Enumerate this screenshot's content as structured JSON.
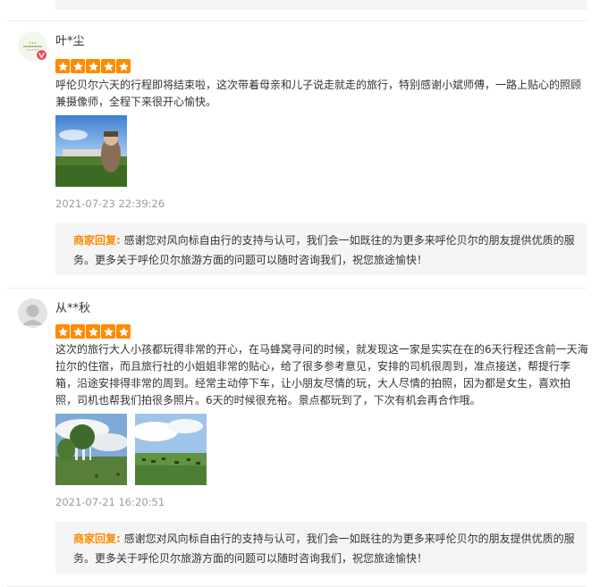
{
  "reviews": [
    {
      "username": "叶*尘",
      "rating": 5,
      "content": "呼伦贝尔六天的行程即将结束啦，这次带着母亲和儿子说走就走的旅行，特别感谢小斌师傅，一路上贴心的照顾兼摄像师，全程下来很开心愉快。",
      "photos": [
        "photo-grassland-figure"
      ],
      "time": "2021-07-23 22:39:26",
      "reply_label": "商家回复:",
      "reply_text": "感谢您对风向标自由行的支持与认可，我们会一如既往的为更多来呼伦贝尔的朋友提供优质的服务。更多关于呼伦贝尔旅游方面的问题可以随时咨询我们，祝您旅途愉快！"
    },
    {
      "username": "从**秋",
      "rating": 5,
      "content": "这次的旅行大人小孩都玩得非常的开心，在马蜂窝寻问的时候，就发现这一家是实实在在的6天行程还含前一天海拉尔的住宿，而且旅行社的小姐姐非常的贴心，给了很多参考意见，安排的司机很周到，准点接送，帮提行李箱，沿途安排得非常的周到。经常主动停下车，让小朋友尽情的玩，大人尽情的拍照，因为都是女生，喜欢拍照，司机也帮我们拍很多照片。6天的时候很充裕。景点都玩到了，下次有机会再合作哦。",
      "photos": [
        "photo-birch-trees",
        "photo-herd-grassland"
      ],
      "time": "2021-07-21 16:20:51",
      "reply_label": "商家回复:",
      "reply_text": "感谢您对风向标自由行的支持与认可，我们会一如既往的为更多来呼伦贝尔的朋友提供优质的服务。更多关于呼伦贝尔旅游方面的问题可以随时咨询我们，祝您旅途愉快！"
    }
  ],
  "colors": {
    "star": "#ff8a00",
    "reply_label": "#ff8a00",
    "reply_bg": "#f5f5f5",
    "time": "#9b9b9b",
    "divider": "#ececec"
  }
}
